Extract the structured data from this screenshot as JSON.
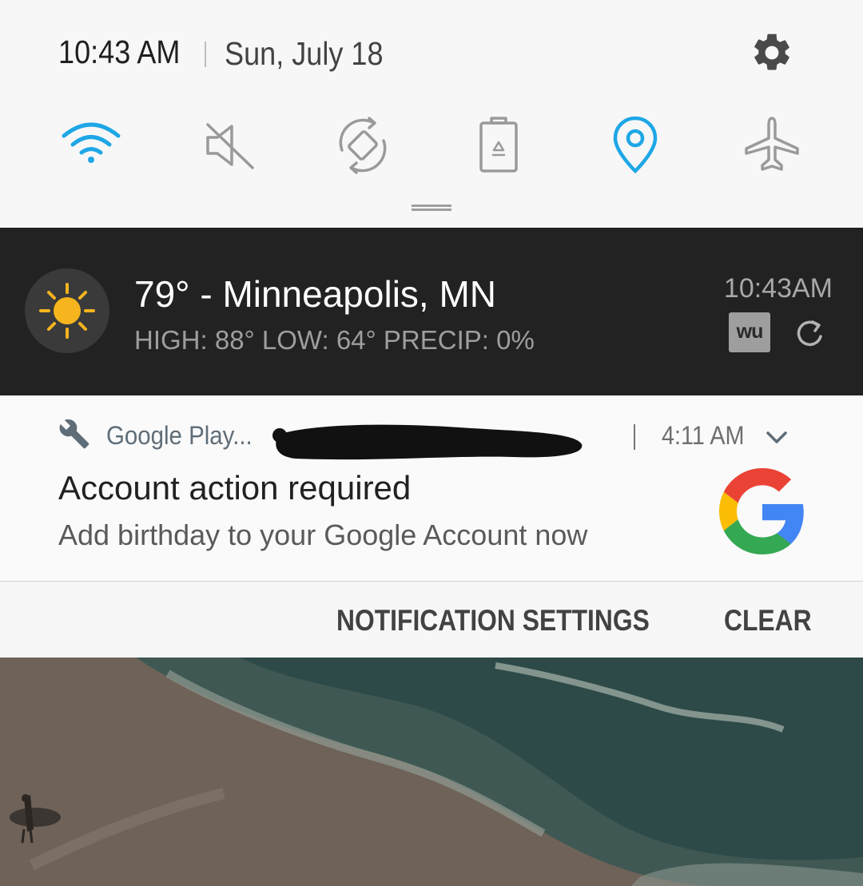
{
  "status": {
    "time": "10:43 AM",
    "date": "Sun, July 18"
  },
  "quick_settings": {
    "toggles": [
      {
        "name": "wifi",
        "icon": "wifi-icon",
        "active": true
      },
      {
        "name": "sound",
        "icon": "mute-icon",
        "active": false
      },
      {
        "name": "auto-rotate",
        "icon": "rotate-icon",
        "active": false
      },
      {
        "name": "power-saving",
        "icon": "battery-saver-icon",
        "active": false
      },
      {
        "name": "location",
        "icon": "location-icon",
        "active": true
      },
      {
        "name": "airplane-mode",
        "icon": "airplane-icon",
        "active": false
      }
    ],
    "active_color": "#1ea7e6",
    "inactive_color": "#9a9a9a"
  },
  "weather": {
    "icon": "sun-icon",
    "title": "79° - Minneapolis, MN",
    "detail": "HIGH: 88° LOW: 64° PRECIP: 0%",
    "updated_time": "10:43AM",
    "provider_logo": "wu"
  },
  "notification": {
    "app_icon": "wrench-icon",
    "app_name": "Google Play...",
    "time": "4:11 AM",
    "title": "Account action required",
    "text": "Add birthday to your Google Account now",
    "large_icon": "google-g-logo"
  },
  "actions": {
    "settings_label": "NOTIFICATION SETTINGS",
    "clear_label": "CLEAR"
  }
}
